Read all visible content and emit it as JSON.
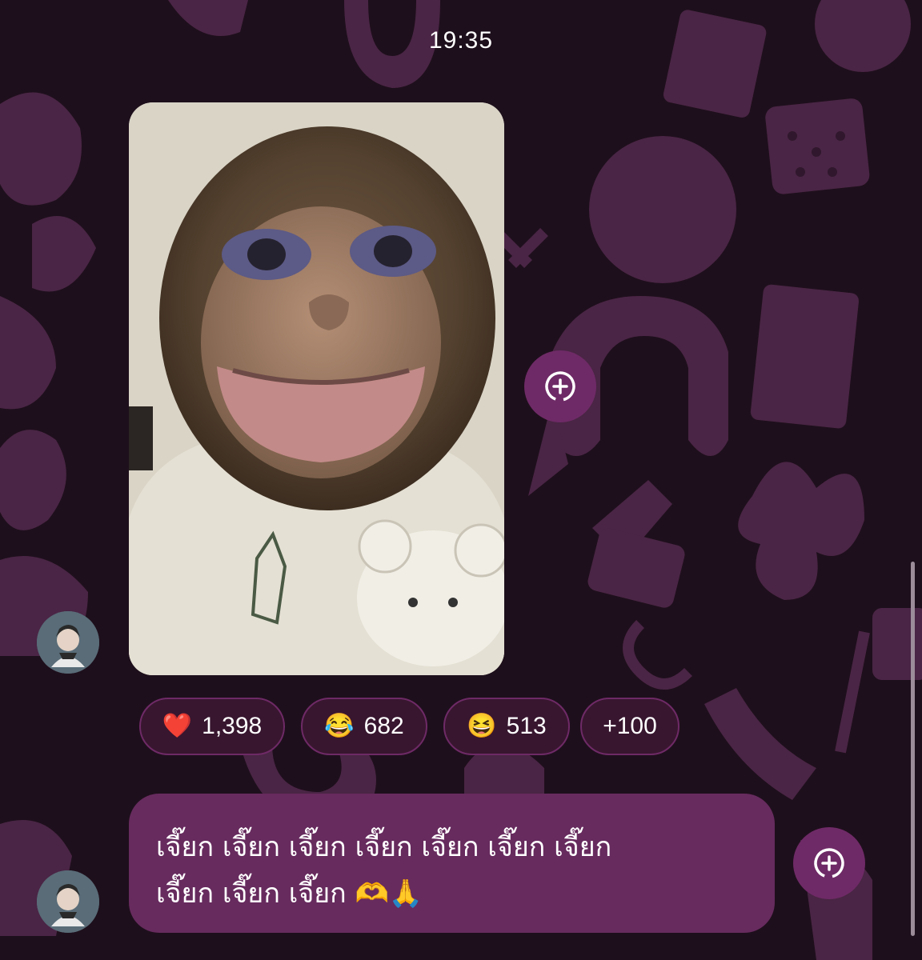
{
  "timestamp": "19:35",
  "reactions": [
    {
      "emoji": "❤️",
      "count": "1,398"
    },
    {
      "emoji": "😂",
      "count": "682"
    },
    {
      "emoji": "😆",
      "count": "513"
    },
    {
      "emoji": "",
      "count": "+100"
    }
  ],
  "message": {
    "text_line1": "เจี๊ยก เจี๊ยก เจี๊ยก เจี๊ยก เจี๊ยก เจี๊ยก เจี๊ยก",
    "text_line2": "เจี๊ยก เจี๊ยก เจี๊ยก",
    "emojis": "🫶🙏"
  },
  "icons": {
    "share": "share-icon",
    "avatar": "avatar",
    "media": "photo"
  },
  "colors": {
    "background": "#1e0f1c",
    "pattern": "#5a2f55",
    "accent": "#6e2a66",
    "bubble": "#672b5e",
    "pill": "#38162f"
  }
}
